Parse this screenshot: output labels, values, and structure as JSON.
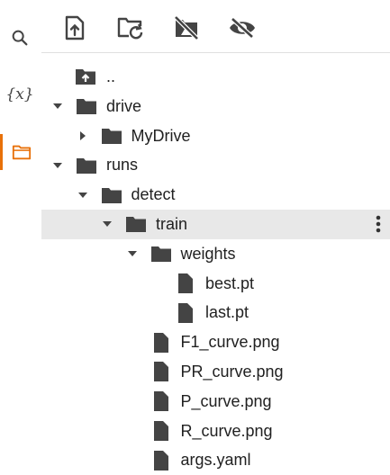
{
  "rail": {
    "items": [
      {
        "name": "search-icon",
        "active": false
      },
      {
        "name": "variables-icon",
        "glyph": "{x}",
        "active": false
      },
      {
        "name": "folder-icon",
        "active": true
      }
    ]
  },
  "toolbar": {
    "buttons": [
      "upload-file-icon",
      "refresh-folder-icon",
      "disconnect-drive-icon",
      "hide-files-icon"
    ]
  },
  "tree": {
    "parent": {
      "label": ".."
    },
    "items": [
      {
        "label": "drive",
        "type": "folder",
        "level": 0,
        "expanded": true
      },
      {
        "label": "MyDrive",
        "type": "folder",
        "level": 1,
        "expanded": false
      },
      {
        "label": "runs",
        "type": "folder",
        "level": 0,
        "expanded": true
      },
      {
        "label": "detect",
        "type": "folder",
        "level": 1,
        "expanded": true
      },
      {
        "label": "train",
        "type": "folder",
        "level": 2,
        "expanded": true,
        "selected": true
      },
      {
        "label": "weights",
        "type": "folder",
        "level": 3,
        "expanded": true
      },
      {
        "label": "best.pt",
        "type": "file",
        "level": 4
      },
      {
        "label": "last.pt",
        "type": "file",
        "level": 4
      },
      {
        "label": "F1_curve.png",
        "type": "file",
        "level": 3
      },
      {
        "label": "PR_curve.png",
        "type": "file",
        "level": 3
      },
      {
        "label": "P_curve.png",
        "type": "file",
        "level": 3
      },
      {
        "label": "R_curve.png",
        "type": "file",
        "level": 3
      },
      {
        "label": "args.yaml",
        "type": "file",
        "level": 3
      }
    ]
  },
  "colors": {
    "accent": "#e8710a",
    "icon": "#444444",
    "selected_row": "#e8e8e8"
  }
}
